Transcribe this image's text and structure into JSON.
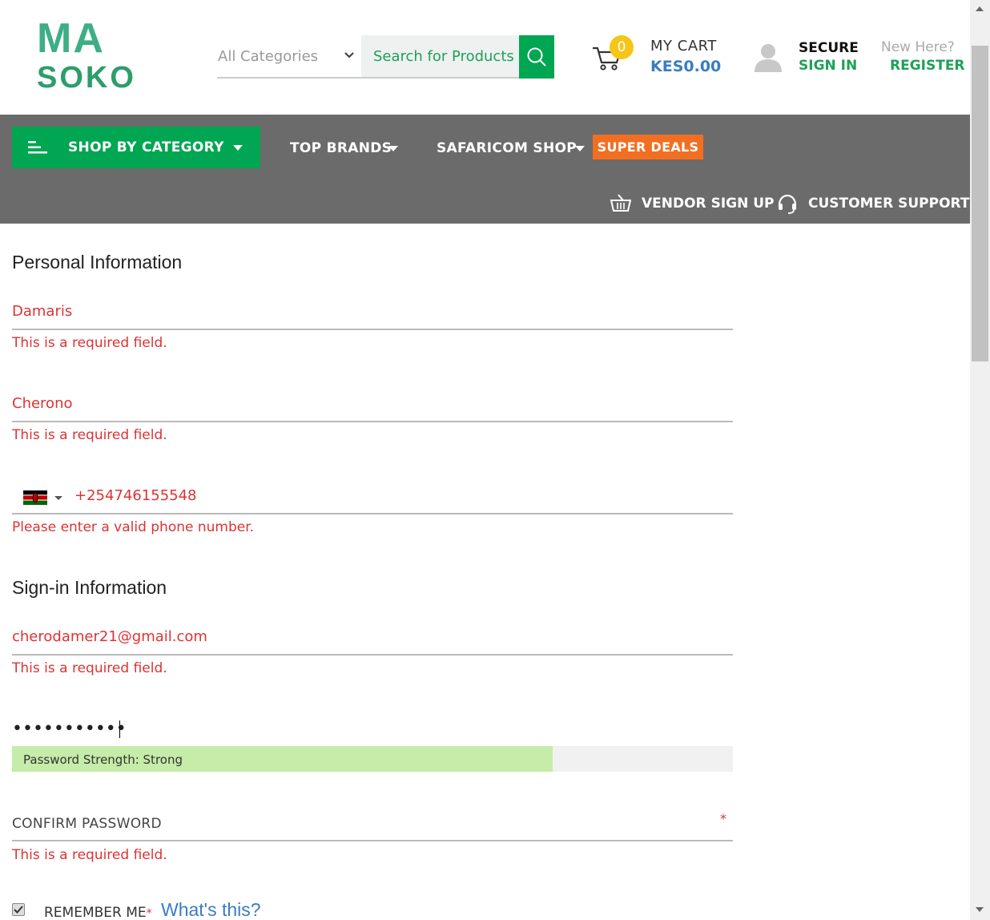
{
  "header": {
    "logo": {
      "top": "MA",
      "bottom": "SOKO"
    },
    "category_select": "All Categories",
    "search_placeholder": "Search for Products",
    "cart": {
      "count": "0",
      "label": "MY CART",
      "amount": "KES0.00"
    },
    "account": {
      "secure_label": "SECURE",
      "signin_label": "SIGN IN",
      "newhere_label": "New Here?",
      "register_label": "REGISTER"
    }
  },
  "nav": {
    "shop_by_category": "SHOP BY CATEGORY",
    "top_brands": "TOP BRANDS",
    "safaricom_shop": "SAFARICOM SHOP",
    "super_deals": "SUPER DEALS",
    "vendor_signup": "VENDOR SIGN UP",
    "customer_support": "CUSTOMER SUPPORT"
  },
  "form": {
    "personal_title": "Personal Information",
    "first_name": "Damaris",
    "first_name_error": "This is a required field.",
    "last_name": "Cherono",
    "last_name_error": "This is a required field.",
    "phone": "+254746155548",
    "phone_error": "Please enter a valid phone number.",
    "signin_title": "Sign-in Information",
    "email": "cherodamer21@gmail.com",
    "email_error": "This is a required field.",
    "password_masked": "•••••••••••",
    "password_strength": "Password Strength: Strong",
    "password_strength_fraction": 0.75,
    "confirm_password_placeholder": "CONFIRM PASSWORD",
    "confirm_required_mark": "*",
    "confirm_error": "This is a required field.",
    "remember_me": "REMEMBER ME",
    "remember_required_mark": "*",
    "whats_this": "What's this?"
  },
  "colors": {
    "brand_green": "#00a651",
    "nav_gray": "#6b6b6b",
    "deals_orange": "#f26f21",
    "error_red": "#dd3333",
    "link_blue": "#3a7dbf"
  }
}
